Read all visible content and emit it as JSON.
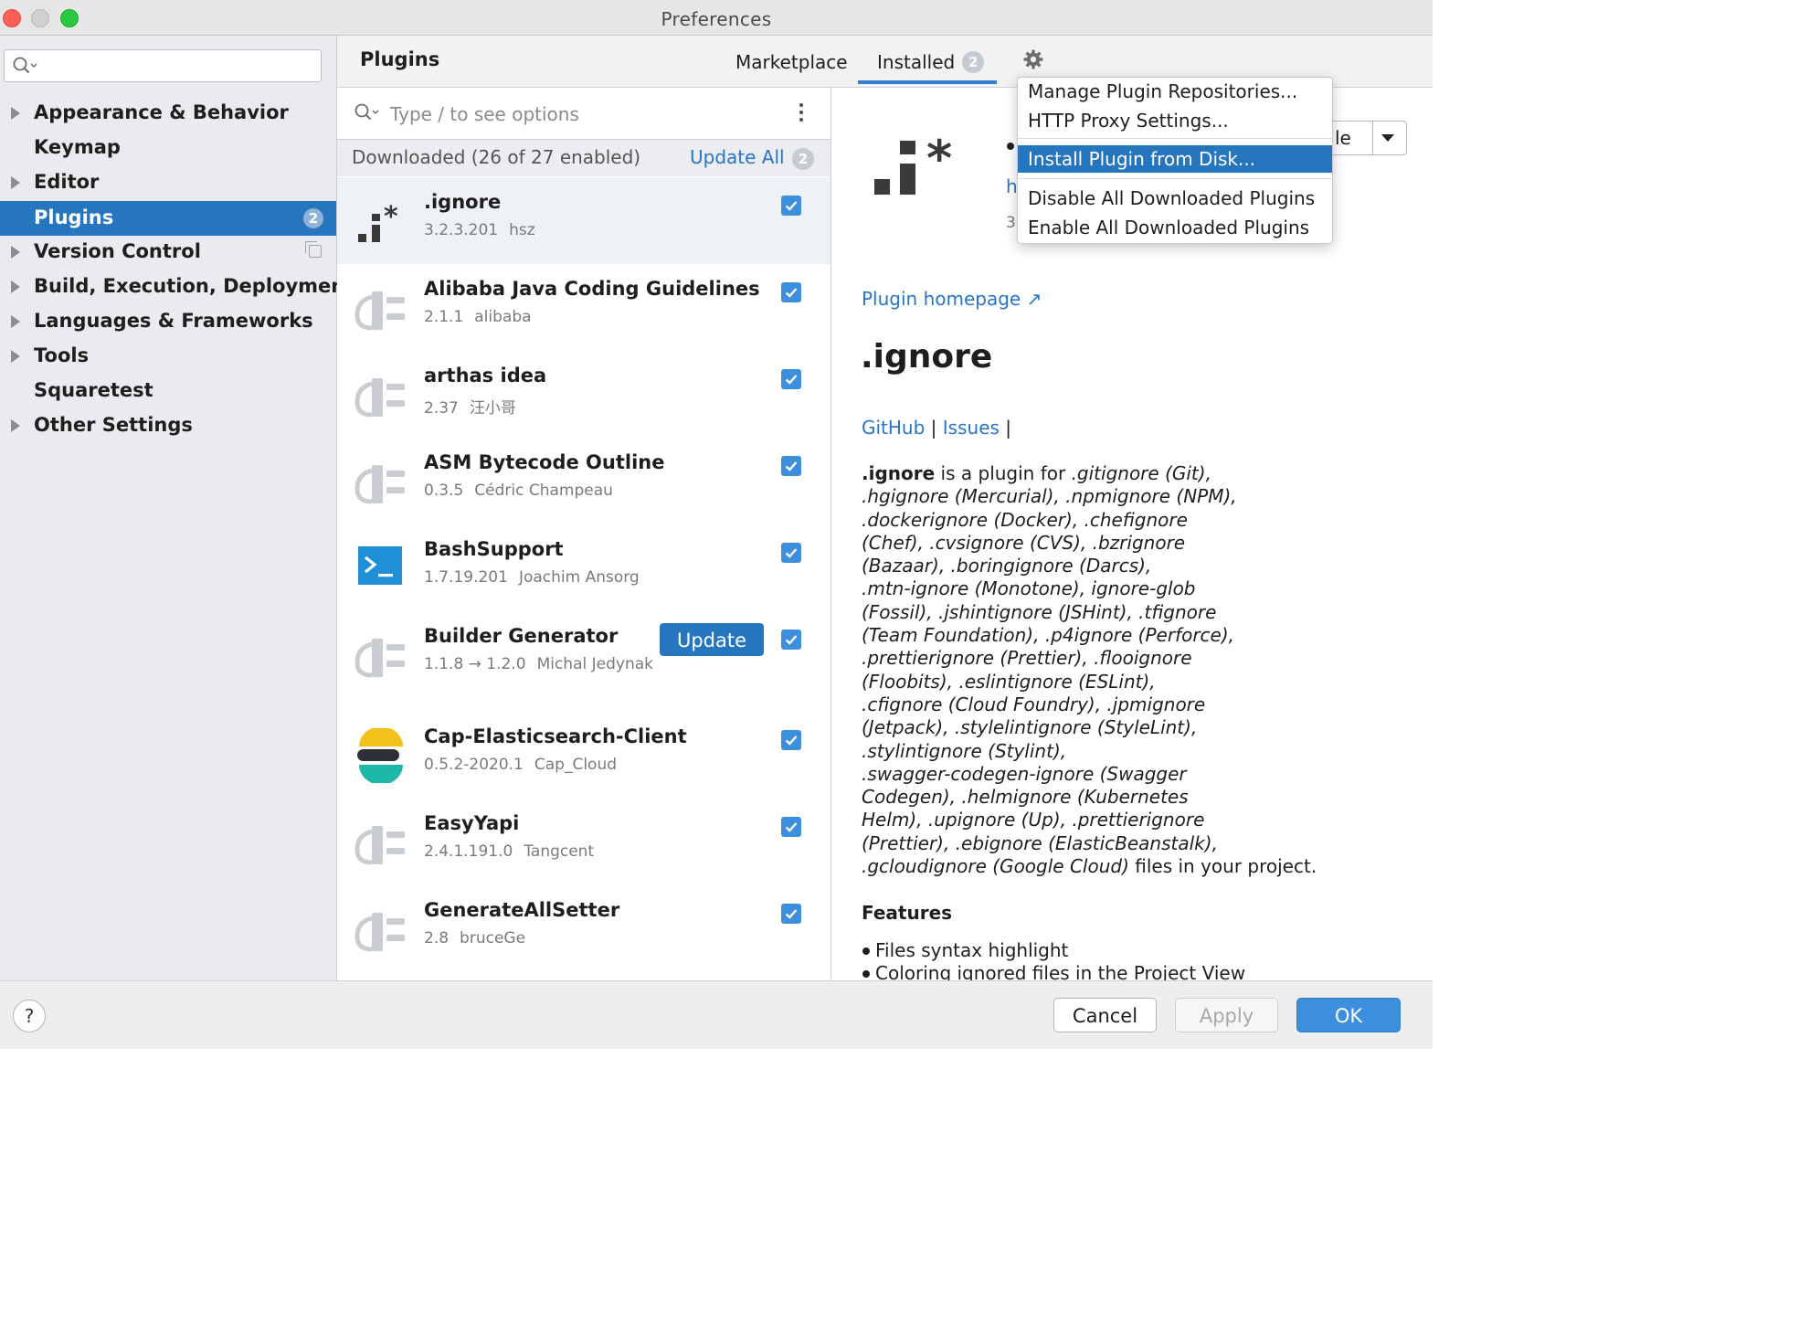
{
  "window": {
    "title": "Preferences"
  },
  "sidebar": {
    "search_placeholder": "",
    "items": [
      {
        "label": "Appearance & Behavior",
        "expandable": true
      },
      {
        "label": "Keymap",
        "expandable": false
      },
      {
        "label": "Editor",
        "expandable": true
      },
      {
        "label": "Plugins",
        "expandable": false,
        "selected": true,
        "badge": "2"
      },
      {
        "label": "Version Control",
        "expandable": true
      },
      {
        "label": "Build, Execution, Deployment",
        "expandable": true
      },
      {
        "label": "Languages & Frameworks",
        "expandable": true
      },
      {
        "label": "Tools",
        "expandable": true
      },
      {
        "label": "Squaretest",
        "expandable": false
      },
      {
        "label": "Other Settings",
        "expandable": true
      }
    ]
  },
  "plugins_header": {
    "title": "Plugins",
    "tabs": [
      {
        "label": "Marketplace"
      },
      {
        "label": "Installed",
        "badge": "2",
        "active": true
      }
    ],
    "settings_icon": "gear-icon"
  },
  "gear_menu": {
    "items": [
      {
        "label": "Manage Plugin Repositories..."
      },
      {
        "label": "HTTP Proxy Settings..."
      },
      {
        "label": "Install Plugin from Disk...",
        "highlighted": true
      },
      {
        "label": "Disable All Downloaded Plugins"
      },
      {
        "label": "Enable All Downloaded Plugins"
      }
    ]
  },
  "plugin_list": {
    "search_placeholder": "Type / to see options",
    "group_title": "Downloaded (26 of 27 enabled)",
    "update_all_label": "Update All",
    "update_all_badge": "2",
    "update_label": "Update",
    "plugins": [
      {
        "name": ".ignore",
        "version": "3.2.3.201",
        "vendor": "hsz",
        "icon": "ignore-logo",
        "enabled": true,
        "selected": true
      },
      {
        "name": "Alibaba Java Coding Guidelines",
        "version": "2.1.1",
        "vendor": "alibaba",
        "icon": "plugin-plug-icon",
        "enabled": true
      },
      {
        "name": "arthas idea",
        "version": "2.37",
        "vendor": "汪小哥",
        "icon": "plugin-plug-icon",
        "enabled": true
      },
      {
        "name": "ASM Bytecode Outline",
        "version": "0.3.5",
        "vendor": "Cédric Champeau",
        "icon": "plugin-plug-icon",
        "enabled": true
      },
      {
        "name": "BashSupport",
        "version": "1.7.19.201",
        "vendor": "Joachim Ansorg",
        "icon": "terminal-icon",
        "enabled": true
      },
      {
        "name": "Builder Generator",
        "version": "1.1.8 → 1.2.0",
        "vendor": "Michal Jedynak",
        "icon": "plugin-plug-icon",
        "enabled": true,
        "has_update": true
      },
      {
        "name": "Cap-Elasticsearch-Client",
        "version": "0.5.2-2020.1",
        "vendor": "Cap_Cloud",
        "icon": "elastic-icon",
        "enabled": true
      },
      {
        "name": "EasyYapi",
        "version": "2.4.1.191.0",
        "vendor": "Tangcent",
        "icon": "plugin-plug-icon",
        "enabled": true
      },
      {
        "name": "GenerateAllSetter",
        "version": "2.8",
        "vendor": "bruceGe",
        "icon": "plugin-plug-icon",
        "enabled": true
      }
    ]
  },
  "detail": {
    "split_button_label": "le",
    "peek_link": "h",
    "peek_text": "3",
    "homepage_link": "Plugin homepage ↗",
    "name": ".ignore",
    "links": [
      {
        "label": "GitHub"
      },
      {
        "label": "Issues"
      }
    ],
    "link_separator": "|",
    "description_lead": ".ignore",
    "description_mid": " is a plugin for ",
    "description_italic": ".gitignore (Git),\n.hgignore (Mercurial), .npmignore (NPM),\n.dockerignore (Docker), .chefignore\n(Chef), .cvsignore (CVS), .bzrignore\n(Bazaar), .boringignore (Darcs),\n.mtn-ignore (Monotone), ignore-glob\n(Fossil), .jshintignore (JSHint), .tfignore\n(Team Foundation), .p4ignore (Perforce),\n.prettierignore (Prettier), .flooignore\n(Floobits), .eslintignore (ESLint),\n.cfignore (Cloud Foundry), .jpmignore\n(Jetpack), .stylelintignore (StyleLint),\n.stylintignore (Stylint),\n.swagger-codegen-ignore (Swagger\nCodegen), .helmignore (Kubernetes\nHelm), .upignore (Up), .prettierignore\n(Prettier), .ebignore (ElasticBeanstalk),\n.gcloudignore (Google Cloud)",
    "description_tail": " files in your project.",
    "features_title": "Features",
    "features": [
      "Files syntax highlight",
      "Coloring ignored files in the Project View"
    ]
  },
  "footer": {
    "help_label": "?",
    "cancel_label": "Cancel",
    "apply_label": "Apply",
    "ok_label": "OK"
  },
  "colors": {
    "accent": "#2675bf",
    "link": "#2875c7",
    "checkbox": "#3c8fdc",
    "sidebar_bg": "#e9ebee"
  }
}
